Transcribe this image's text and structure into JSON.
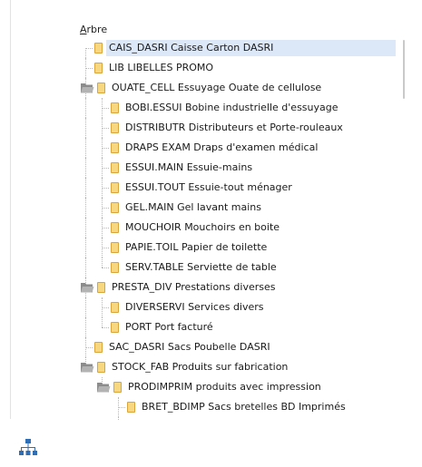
{
  "panel": {
    "label": "Arbre"
  },
  "tree": [
    {
      "level": 0,
      "expanded": false,
      "selected": true,
      "text": "CAIS_DASRI Caisse Carton DASRI"
    },
    {
      "level": 0,
      "expanded": false,
      "selected": false,
      "text": "LIB LIBELLES PROMO"
    },
    {
      "level": 0,
      "expanded": true,
      "selected": false,
      "text": "OUATE_CELL Essuyage Ouate de cellulose"
    },
    {
      "level": 1,
      "expanded": false,
      "selected": false,
      "text": "BOBI.ESSUI Bobine industrielle d'essuyage"
    },
    {
      "level": 1,
      "expanded": false,
      "selected": false,
      "text": "DISTRIBUTR Distributeurs et Porte-rouleaux"
    },
    {
      "level": 1,
      "expanded": false,
      "selected": false,
      "text": "DRAPS EXAM Draps d'examen médical"
    },
    {
      "level": 1,
      "expanded": false,
      "selected": false,
      "text": "ESSUI.MAIN Essuie-mains"
    },
    {
      "level": 1,
      "expanded": false,
      "selected": false,
      "text": "ESSUI.TOUT Essuie-tout ménager"
    },
    {
      "level": 1,
      "expanded": false,
      "selected": false,
      "text": "GEL.MAIN Gel lavant mains"
    },
    {
      "level": 1,
      "expanded": false,
      "selected": false,
      "text": "MOUCHOIR Mouchoirs en boite"
    },
    {
      "level": 1,
      "expanded": false,
      "selected": false,
      "text": "PAPIE.TOIL Papier de toilette"
    },
    {
      "level": 1,
      "expanded": false,
      "selected": false,
      "text": "SERV.TABLE Serviette de table"
    },
    {
      "level": 0,
      "expanded": true,
      "selected": false,
      "text": "PRESTA_DIV Prestations diverses"
    },
    {
      "level": 1,
      "expanded": false,
      "selected": false,
      "text": "DIVERSERVI Services divers"
    },
    {
      "level": 1,
      "expanded": false,
      "selected": false,
      "text": "PORT Port facturé"
    },
    {
      "level": 0,
      "expanded": false,
      "selected": false,
      "text": "SAC_DASRI Sacs Poubelle DASRI"
    },
    {
      "level": 0,
      "expanded": true,
      "selected": false,
      "text": "STOCK_FAB Produits sur fabrication"
    },
    {
      "level": 1,
      "expanded": true,
      "selected": false,
      "text": "PRODIMPRIM produits avec impression"
    },
    {
      "level": 2,
      "expanded": false,
      "selected": false,
      "text": "BRET_BDIMP Sacs bretelles BD Imprimés"
    },
    {
      "level": 2,
      "expanded": false,
      "selected": false,
      "text": ""
    }
  ],
  "icons": {
    "folder_closed": "folder-icon",
    "folder_open": "folder-open-icon",
    "hierarchy": "hierarchy-icon"
  },
  "colors": {
    "selection": "#dce8f7",
    "folder": "#f7d780",
    "folder_border": "#d9a43a",
    "hierarchy": "#2f6db5"
  }
}
